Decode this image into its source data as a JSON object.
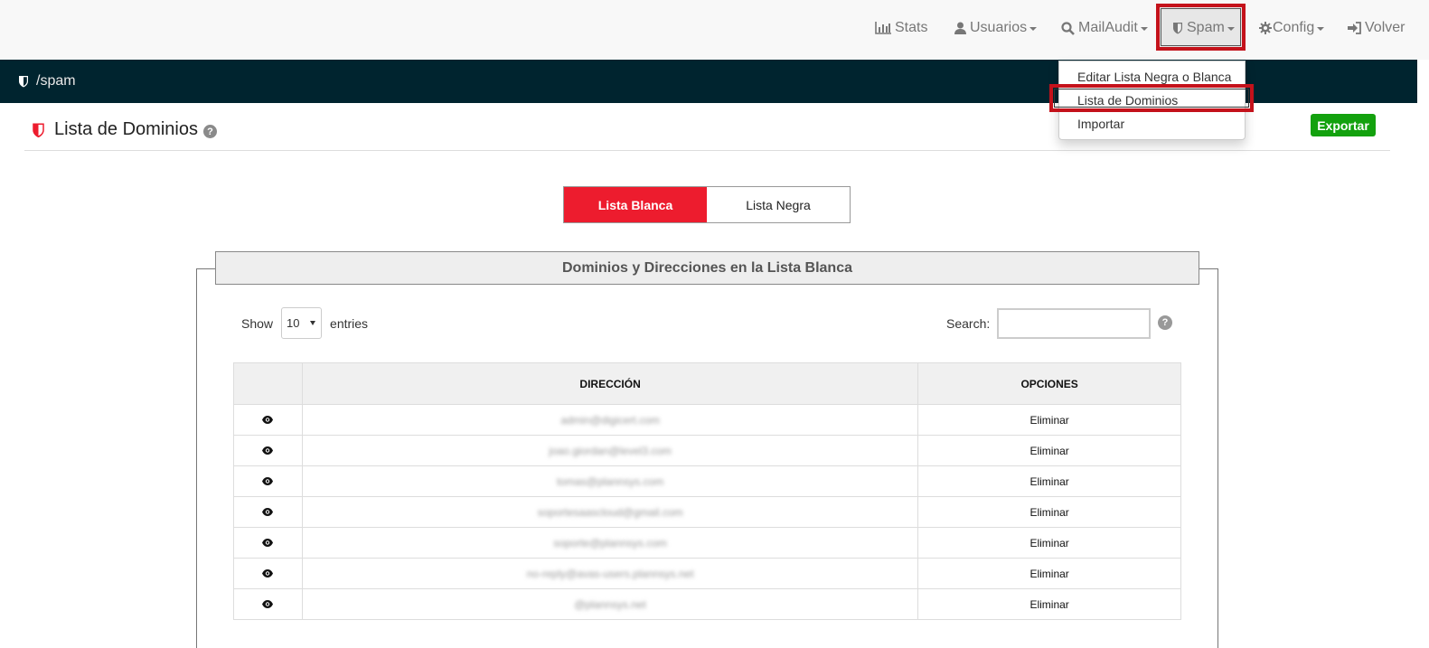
{
  "nav": {
    "stats": "Stats",
    "usuarios": "Usuarios",
    "mailaudit": "MailAudit",
    "spam": "Spam",
    "config": "Config",
    "volver": "Volver"
  },
  "dropdown": {
    "items": [
      "Editar Lista Negra o Blanca",
      "Lista de Dominios",
      "Importar"
    ]
  },
  "breadcrumb": "/spam",
  "page": {
    "title": "Lista de Dominios",
    "help": "?",
    "export_label": "Exportar"
  },
  "toggle": {
    "white": "Lista Blanca",
    "black": "Lista Negra"
  },
  "panel": {
    "title": "Dominios y Direcciones en la Lista Blanca"
  },
  "controls": {
    "show_label": "Show",
    "show_value": "10",
    "entries_label": "entries",
    "search_label": "Search:",
    "search_help": "?"
  },
  "table": {
    "headers": [
      "",
      "DIRECCIÓN",
      "OPCIONES"
    ],
    "rows": [
      {
        "address": "admin@digicert.com",
        "option": "Eliminar"
      },
      {
        "address": "joao.giordan@level3.com",
        "option": "Eliminar"
      },
      {
        "address": "tomas@plannsys.com",
        "option": "Eliminar"
      },
      {
        "address": "soportesaascloud@gmail.com",
        "option": "Eliminar"
      },
      {
        "address": "soporte@plannsys.com",
        "option": "Eliminar"
      },
      {
        "address": "no-reply@avas-users.plannsys.net",
        "option": "Eliminar"
      },
      {
        "address": "@plannsys.net",
        "option": "Eliminar"
      }
    ]
  },
  "colors": {
    "accent_red": "#ed1c2e",
    "dark_bar": "#00242f",
    "export_green": "#13a10e",
    "highlight_red": "#c4121b"
  }
}
